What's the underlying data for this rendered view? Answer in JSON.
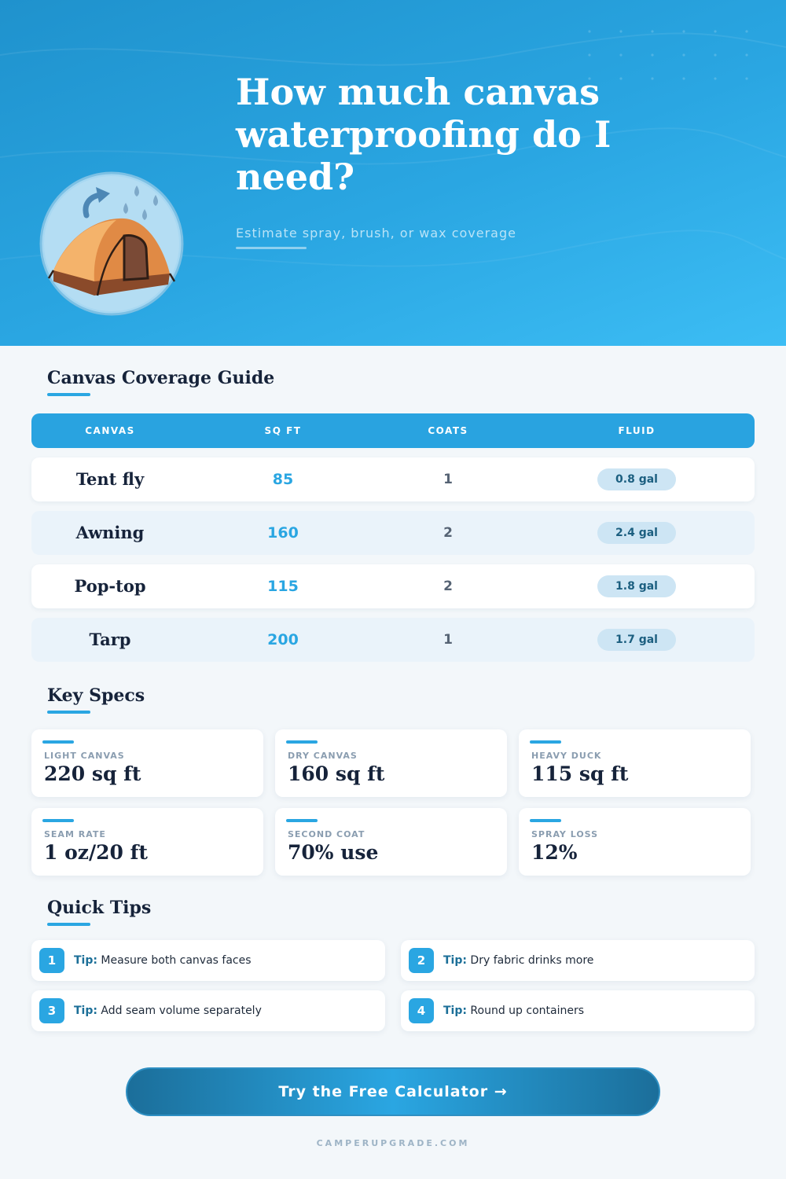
{
  "hero": {
    "title": "How much canvas waterproofing do I need?",
    "subtitle": "Estimate spray, brush, or wax coverage"
  },
  "coverage": {
    "title": "Canvas Coverage Guide",
    "headers": [
      "CANVAS",
      "SQ FT",
      "COATS",
      "FLUID"
    ],
    "rows": [
      {
        "name": "Tent fly",
        "sqft": "85",
        "coats": "1",
        "fluid": "0.8 gal"
      },
      {
        "name": "Awning",
        "sqft": "160",
        "coats": "2",
        "fluid": "2.4 gal"
      },
      {
        "name": "Pop-top",
        "sqft": "115",
        "coats": "2",
        "fluid": "1.8 gal"
      },
      {
        "name": "Tarp",
        "sqft": "200",
        "coats": "1",
        "fluid": "1.7 gal"
      }
    ]
  },
  "specs": {
    "title": "Key Specs",
    "items": [
      {
        "label": "LIGHT CANVAS",
        "value": "220 sq ft"
      },
      {
        "label": "DRY CANVAS",
        "value": "160 sq ft"
      },
      {
        "label": "HEAVY DUCK",
        "value": "115 sq ft"
      },
      {
        "label": "SEAM RATE",
        "value": "1 oz/20 ft"
      },
      {
        "label": "SECOND COAT",
        "value": "70% use"
      },
      {
        "label": "SPRAY LOSS",
        "value": "12%"
      }
    ]
  },
  "tips": {
    "title": "Quick Tips",
    "prefix": "Tip:",
    "items": [
      {
        "num": "1",
        "text": "Measure both canvas faces"
      },
      {
        "num": "2",
        "text": "Dry fabric drinks more"
      },
      {
        "num": "3",
        "text": "Add seam volume separately"
      },
      {
        "num": "4",
        "text": "Round up containers"
      }
    ]
  },
  "cta": {
    "label": "Try the Free Calculator →"
  },
  "footer": {
    "text": "CAMPERUPGRADE.COM"
  },
  "icons": {
    "hero": "tent-rain-icon"
  },
  "colors": {
    "accent": "#2aa6e2",
    "hero_start": "#1f92cd",
    "hero_end": "#3cbdf4",
    "heading": "#16233a",
    "pill": "#cde5f4"
  }
}
